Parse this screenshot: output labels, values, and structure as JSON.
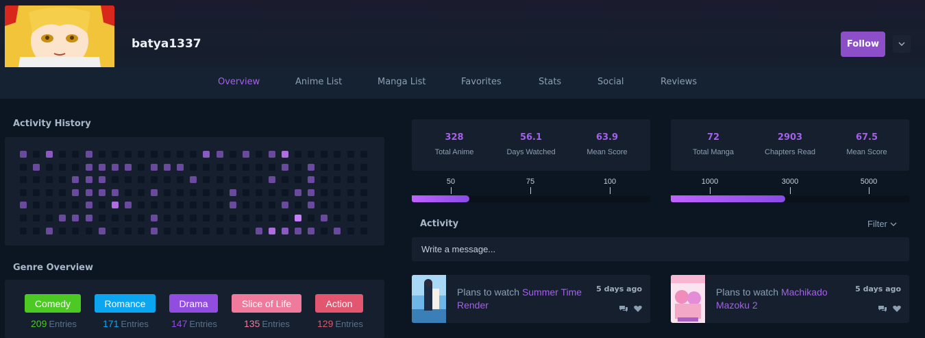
{
  "profile": {
    "username": "batya1337",
    "follow_label": "Follow"
  },
  "nav": {
    "items": [
      "Overview",
      "Anime List",
      "Manga List",
      "Favorites",
      "Stats",
      "Social",
      "Reviews"
    ],
    "active": "Overview"
  },
  "activity_history": {
    "title": "Activity History",
    "levels": [
      [
        1,
        0,
        2,
        0,
        0,
        1,
        0,
        0,
        0,
        0,
        0,
        0,
        0,
        0,
        2,
        1,
        0,
        1,
        0,
        1,
        3,
        0,
        0,
        0,
        0,
        0,
        0,
        0,
        0
      ],
      [
        0,
        1,
        0,
        0,
        0,
        1,
        1,
        1,
        1,
        0,
        1,
        1,
        1,
        0,
        0,
        0,
        0,
        0,
        0,
        0,
        1,
        0,
        1,
        0,
        0,
        0,
        0,
        0,
        0
      ],
      [
        0,
        0,
        0,
        0,
        1,
        1,
        1,
        0,
        0,
        0,
        0,
        0,
        0,
        1,
        0,
        0,
        0,
        0,
        0,
        1,
        0,
        0,
        1,
        0,
        0,
        0,
        0,
        0,
        0
      ],
      [
        0,
        0,
        0,
        0,
        1,
        1,
        1,
        1,
        0,
        0,
        1,
        0,
        0,
        0,
        0,
        0,
        1,
        0,
        0,
        0,
        0,
        1,
        1,
        0,
        0,
        0,
        0,
        0,
        0
      ],
      [
        1,
        0,
        0,
        0,
        0,
        1,
        0,
        3,
        1,
        0,
        0,
        0,
        0,
        0,
        0,
        0,
        1,
        0,
        0,
        0,
        1,
        0,
        1,
        0,
        0,
        0,
        0,
        0,
        0
      ],
      [
        0,
        0,
        0,
        1,
        1,
        1,
        0,
        0,
        0,
        0,
        1,
        0,
        0,
        0,
        0,
        0,
        0,
        0,
        0,
        0,
        0,
        4,
        0,
        1,
        0,
        0,
        0,
        0,
        0
      ],
      [
        0,
        0,
        1,
        0,
        0,
        0,
        1,
        0,
        0,
        0,
        1,
        0,
        0,
        0,
        0,
        0,
        0,
        0,
        1,
        3,
        2,
        1,
        1,
        0,
        1,
        0,
        0,
        0,
        0
      ]
    ]
  },
  "genre_overview": {
    "title": "Genre Overview",
    "entries_label": "Entries",
    "genres": [
      {
        "name": "Comedy",
        "count": "209",
        "color": "#4cca23"
      },
      {
        "name": "Romance",
        "count": "171",
        "color": "#0ba6ef"
      },
      {
        "name": "Drama",
        "count": "147",
        "color": "#914de0"
      },
      {
        "name": "Slice of Life",
        "count": "135",
        "color": "#f07a9b"
      },
      {
        "name": "Action",
        "count": "129",
        "color": "#e25670"
      }
    ]
  },
  "anime_stats": {
    "stats": [
      {
        "value": "328",
        "label": "Total Anime"
      },
      {
        "value": "56.1",
        "label": "Days Watched"
      },
      {
        "value": "63.9",
        "label": "Mean Score"
      }
    ],
    "ticks": [
      "50",
      "75",
      "100"
    ],
    "progress": 0.24
  },
  "manga_stats": {
    "stats": [
      {
        "value": "72",
        "label": "Total Manga"
      },
      {
        "value": "2903",
        "label": "Chapters Read"
      },
      {
        "value": "67.5",
        "label": "Mean Score"
      }
    ],
    "ticks": [
      "1000",
      "3000",
      "5000"
    ],
    "progress": 0.48
  },
  "activity": {
    "title": "Activity",
    "filter_label": "Filter",
    "message_placeholder": "Write a message...",
    "items": [
      {
        "action": "Plans to watch ",
        "title": "Summer Time Render",
        "time": "5 days ago"
      },
      {
        "action": "Plans to watch ",
        "title": "Machikado Mazoku 2",
        "time": "5 days ago"
      }
    ]
  },
  "colors": {
    "accent": "#a361e8",
    "follow_button": "#8c4fc7",
    "background": "#0b1622",
    "panel": "#151f2e"
  }
}
